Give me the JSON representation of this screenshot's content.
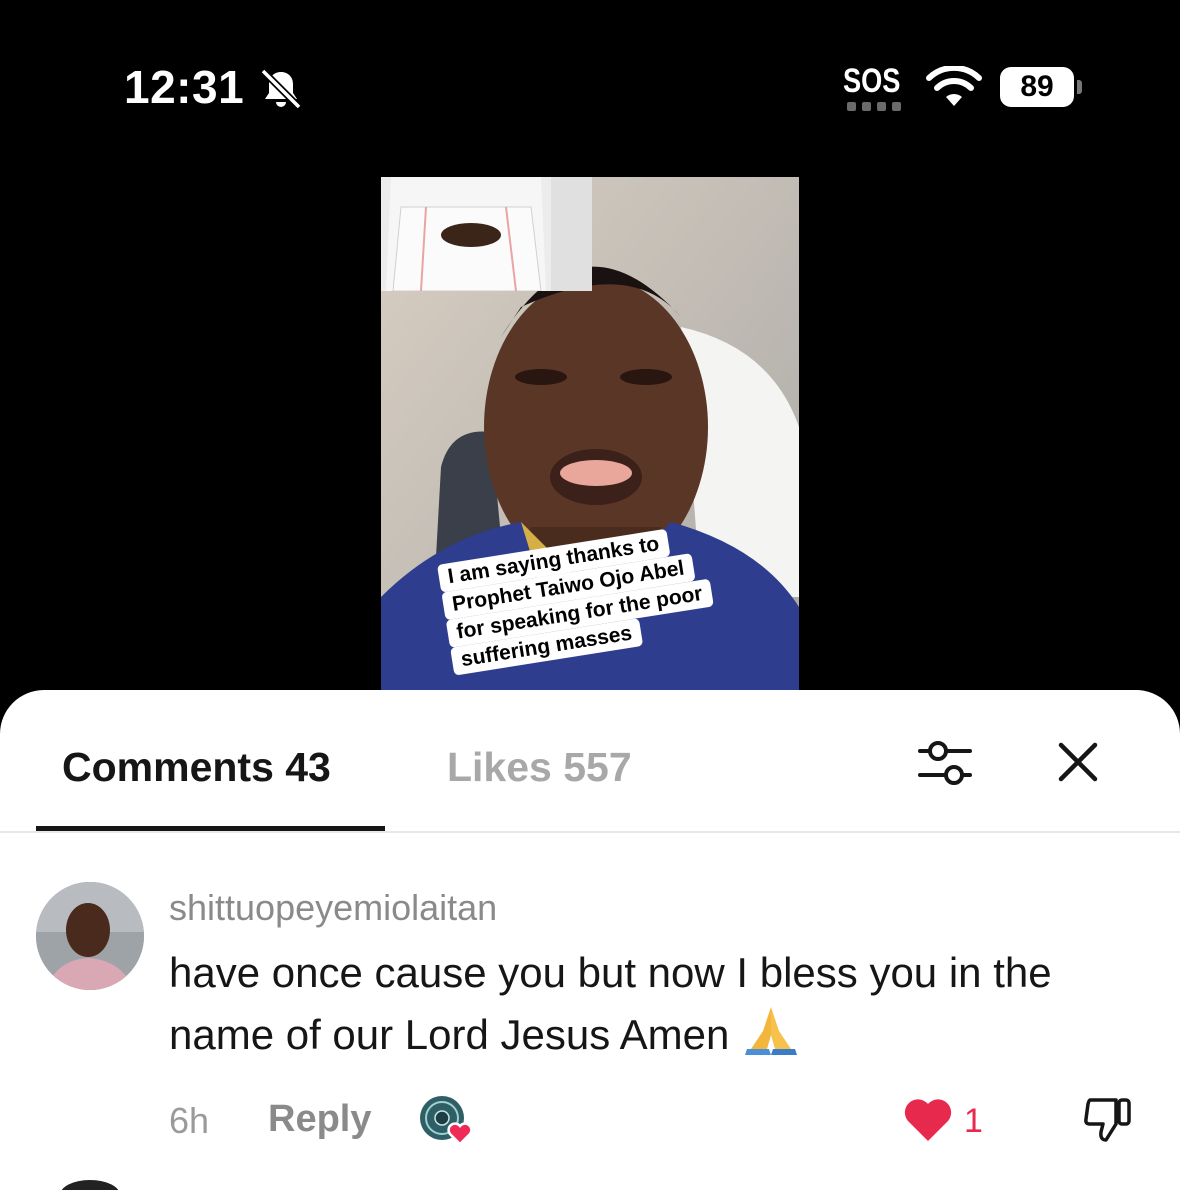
{
  "status_bar": {
    "time": "12:31",
    "carrier": "SOS",
    "battery": "89",
    "icons": [
      "bell-slash-icon",
      "wifi-icon",
      "battery-icon"
    ]
  },
  "video": {
    "caption_lines": [
      "I am saying thanks to",
      "Prophet Taiwo Ojo Abel",
      "for speaking for the poor",
      "suffering masses"
    ]
  },
  "comments_sheet": {
    "tabs": [
      {
        "label": "Comments 43",
        "active": true
      },
      {
        "label": "Likes 557",
        "active": false
      }
    ],
    "icons": {
      "filter": "sliders-icon",
      "close": "close-icon"
    },
    "comments": [
      {
        "username": "shittuopeyemiolaitan",
        "text": "have once cause you but now I bless you in the name of our Lord Jesus Amen",
        "emoji": "folded-hands",
        "time": "6h",
        "reply_label": "Reply",
        "likes": "1"
      }
    ]
  },
  "colors": {
    "background": "#000000",
    "sheet": "#ffffff",
    "like_red": "#e8294e",
    "muted_text": "#8a8a8a"
  }
}
